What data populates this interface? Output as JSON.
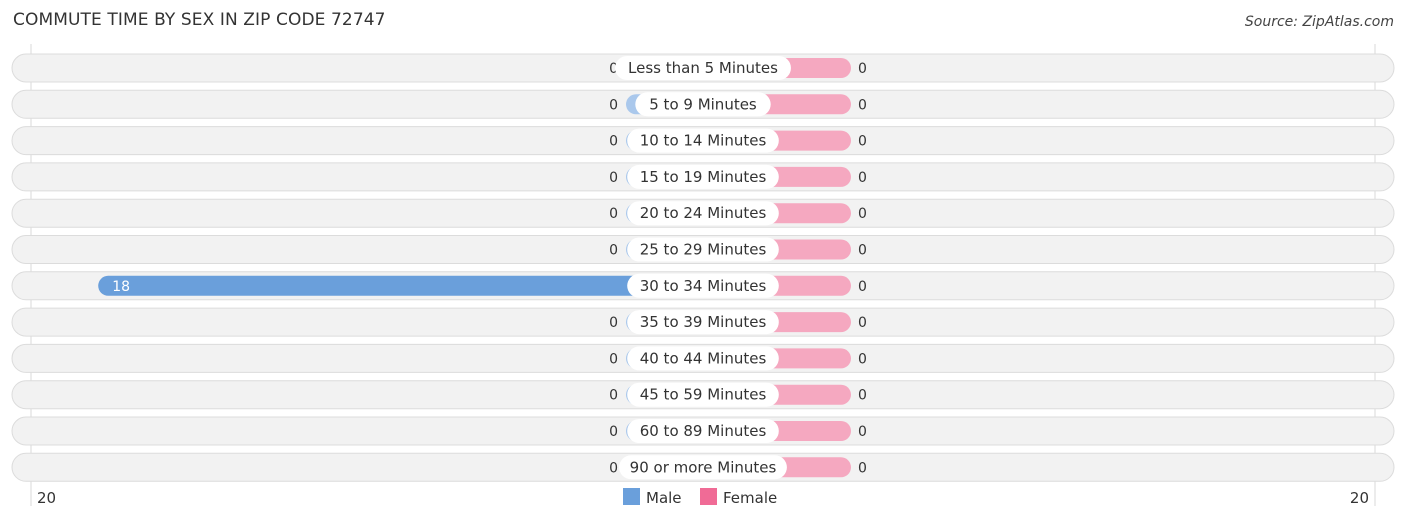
{
  "title": "COMMUTE TIME BY SEX IN ZIP CODE 72747",
  "source": "Source: ZipAtlas.com",
  "chart_data": {
    "type": "bar",
    "orientation": "horizontal-diverging",
    "title": "COMMUTE TIME BY SEX IN ZIP CODE 72747",
    "categories": [
      "Less than 5 Minutes",
      "5 to 9 Minutes",
      "10 to 14 Minutes",
      "15 to 19 Minutes",
      "20 to 24 Minutes",
      "25 to 29 Minutes",
      "30 to 34 Minutes",
      "35 to 39 Minutes",
      "40 to 44 Minutes",
      "45 to 59 Minutes",
      "60 to 89 Minutes",
      "90 or more Minutes"
    ],
    "series": [
      {
        "name": "Male",
        "color": "#6a9fdb",
        "light_color": "#aac8ec",
        "values": [
          0,
          0,
          0,
          0,
          0,
          0,
          18,
          0,
          0,
          0,
          0,
          0
        ]
      },
      {
        "name": "Female",
        "color": "#f06b96",
        "light_color": "#f5a8c0",
        "values": [
          0,
          0,
          0,
          0,
          0,
          0,
          0,
          0,
          0,
          0,
          0,
          0
        ]
      }
    ],
    "axis": {
      "left_label": "20",
      "right_label": "20",
      "max": 20
    },
    "legend": {
      "position": "bottom-center",
      "items": [
        "Male",
        "Female"
      ]
    }
  }
}
